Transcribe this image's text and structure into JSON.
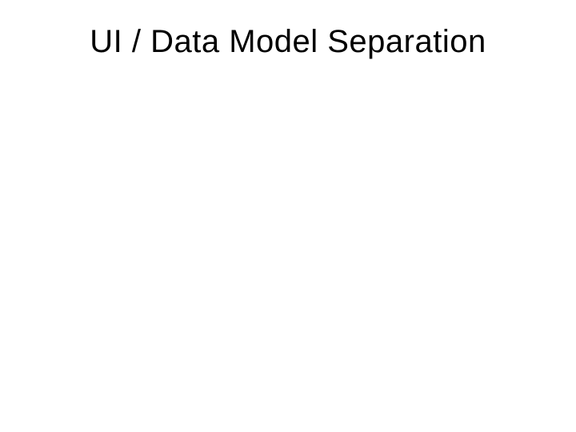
{
  "slide": {
    "title": "UI / Data Model Separation"
  }
}
